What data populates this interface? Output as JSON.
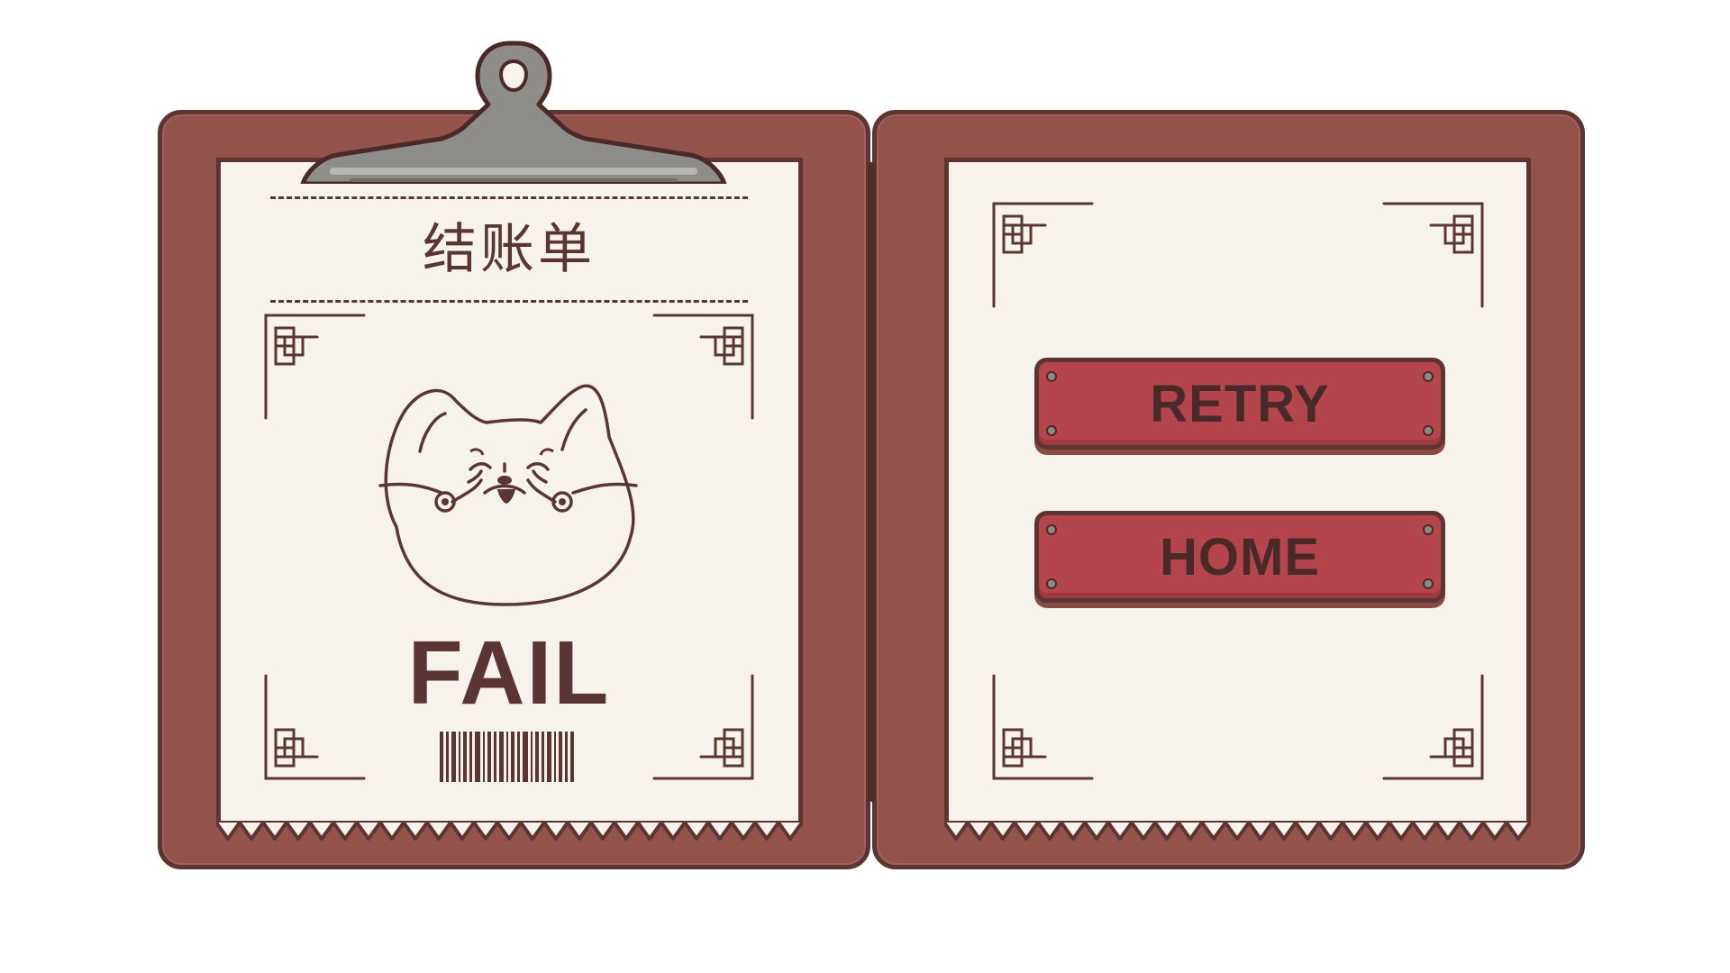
{
  "receipt": {
    "title": "结账单",
    "result": "FAIL"
  },
  "menu": {
    "retry_label": "RETRY",
    "home_label": "HOME"
  },
  "colors": {
    "folder": "#93524a",
    "paper": "#f7f3ec",
    "ink": "#5b3531",
    "button": "#b5454c",
    "clip": "#8e8d8a"
  },
  "icons": {
    "mascot": "crying-shiba-icon",
    "barcode": "barcode-icon",
    "clip": "clipboard-clip-icon",
    "corner": "chinese-knot-corner-icon"
  }
}
